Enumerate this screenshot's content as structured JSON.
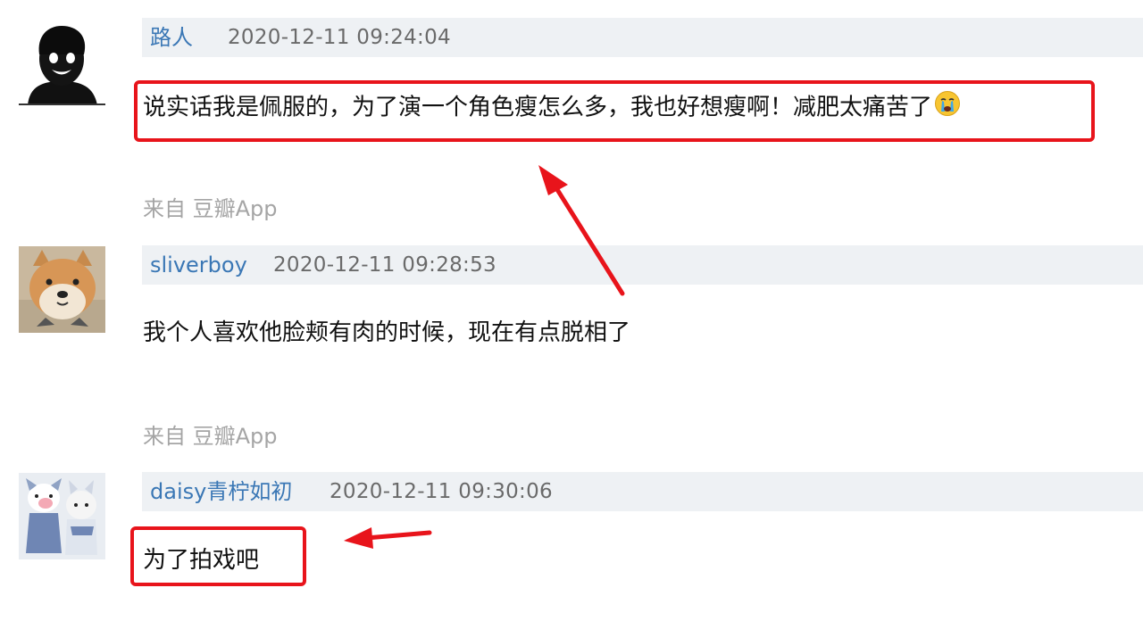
{
  "comments": [
    {
      "author": "路人",
      "timestamp": "2020-12-11 09:24:04",
      "text": "说实话我是佩服的，为了演一个角色瘦怎么多，我也好想瘦啊！减肥太痛苦了",
      "emoji": "crying-face-icon",
      "source": "来自 豆瓣App"
    },
    {
      "author": "sliverboy",
      "timestamp": "2020-12-11 09:28:53",
      "text": "我个人喜欢他脸颊有肉的时候，现在有点脱相了",
      "source": "来自 豆瓣App"
    },
    {
      "author": "daisy青柠如初",
      "timestamp": "2020-12-11 09:30:06",
      "text": "为了拍戏吧"
    }
  ],
  "colors": {
    "author_link": "#3a77b5",
    "meta_bar": "#eef1f4",
    "annotation_red": "#e8141b",
    "source_text": "#a5a5a5"
  }
}
